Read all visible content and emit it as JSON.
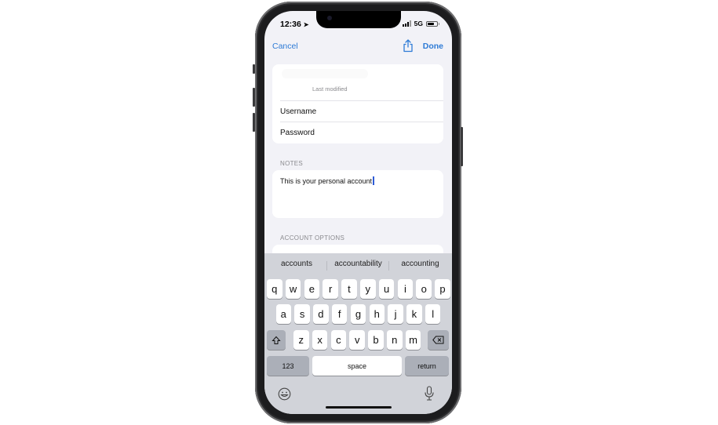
{
  "status_bar": {
    "time": "12:36",
    "network": "5G"
  },
  "nav": {
    "cancel_label": "Cancel",
    "done_label": "Done",
    "share_icon": "share-icon"
  },
  "account_card": {
    "title_redacted": "",
    "last_modified_label": "Last modified",
    "fields": [
      {
        "label": "Username"
      },
      {
        "label": "Password"
      }
    ]
  },
  "notes": {
    "header": "NOTES",
    "text": "This is your personal account"
  },
  "account_options": {
    "header": "ACCOUNT OPTIONS"
  },
  "keyboard": {
    "suggestions": [
      "accounts",
      "accountability",
      "accounting"
    ],
    "row1": [
      "q",
      "w",
      "e",
      "r",
      "t",
      "y",
      "u",
      "i",
      "o",
      "p"
    ],
    "row2": [
      "a",
      "s",
      "d",
      "f",
      "g",
      "h",
      "j",
      "k",
      "l"
    ],
    "row3": [
      "z",
      "x",
      "c",
      "v",
      "b",
      "n",
      "m"
    ],
    "numbers_label": "123",
    "space_label": "space",
    "return_label": "return",
    "shift_icon": "shift-icon",
    "delete_icon": "backspace-icon",
    "emoji_icon": "emoji-icon",
    "mic_icon": "microphone-icon"
  }
}
